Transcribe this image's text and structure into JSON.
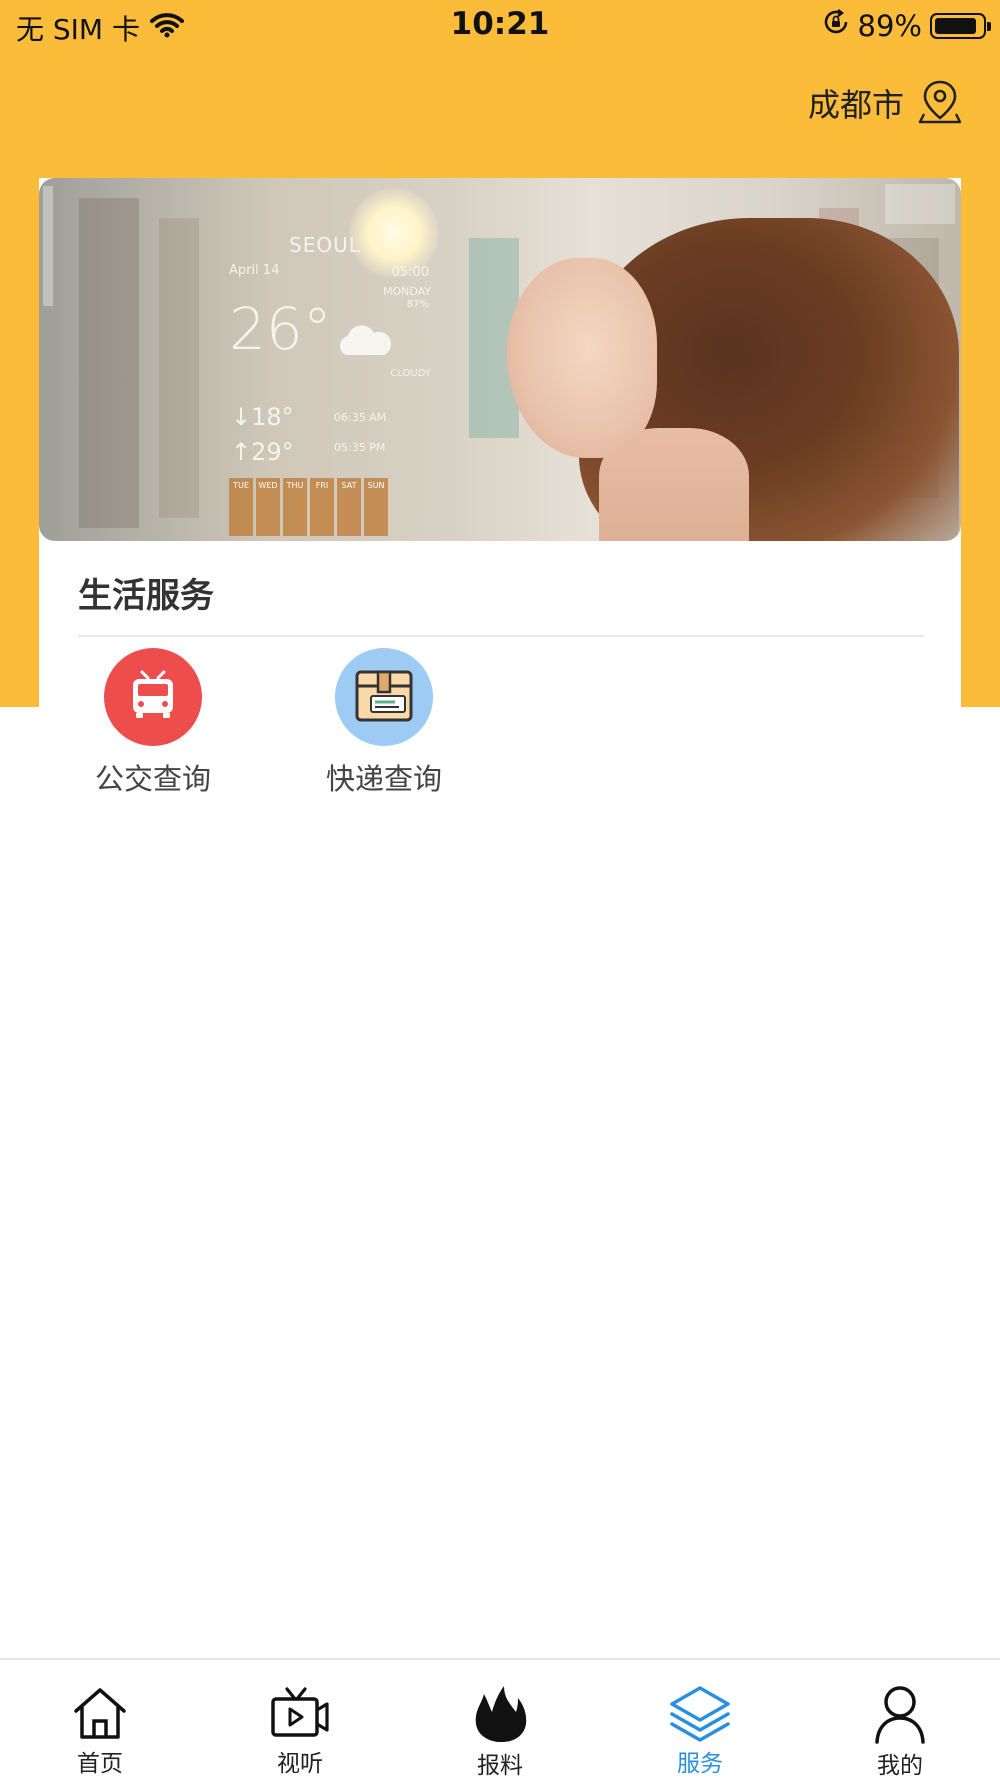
{
  "status_bar": {
    "carrier": "无 SIM 卡",
    "time": "10:21",
    "battery": "89%"
  },
  "location": {
    "city": "成都市"
  },
  "banner": {
    "weather": {
      "city": "SEOUL",
      "date": "April 14",
      "time": "05:00",
      "day": "MONDAY",
      "humidity": "87%",
      "temperature": "26°",
      "condition": "CLOUDY",
      "low": "↓18°",
      "high": "↑29°",
      "sunrise": "06:35 AM",
      "sunset": "05:35 PM",
      "forecast": [
        "TUE",
        "WED",
        "THU",
        "FRI",
        "SAT",
        "SUN"
      ]
    }
  },
  "section": {
    "title": "生活服务"
  },
  "services": [
    {
      "label": "公交查询",
      "icon": "bus-icon",
      "color": "#EE4E4B"
    },
    {
      "label": "快递查询",
      "icon": "package-icon",
      "color": "#9DCBF4"
    }
  ],
  "tabbar": {
    "active_color": "#2A8FE0",
    "items": [
      {
        "label": "首页",
        "icon": "home-icon"
      },
      {
        "label": "视听",
        "icon": "tv-icon"
      },
      {
        "label": "报料",
        "icon": "flame-icon"
      },
      {
        "label": "服务",
        "icon": "layers-icon",
        "active": true
      },
      {
        "label": "我的",
        "icon": "user-icon"
      }
    ]
  },
  "theme": {
    "header_bg": "#FBBC3A"
  }
}
